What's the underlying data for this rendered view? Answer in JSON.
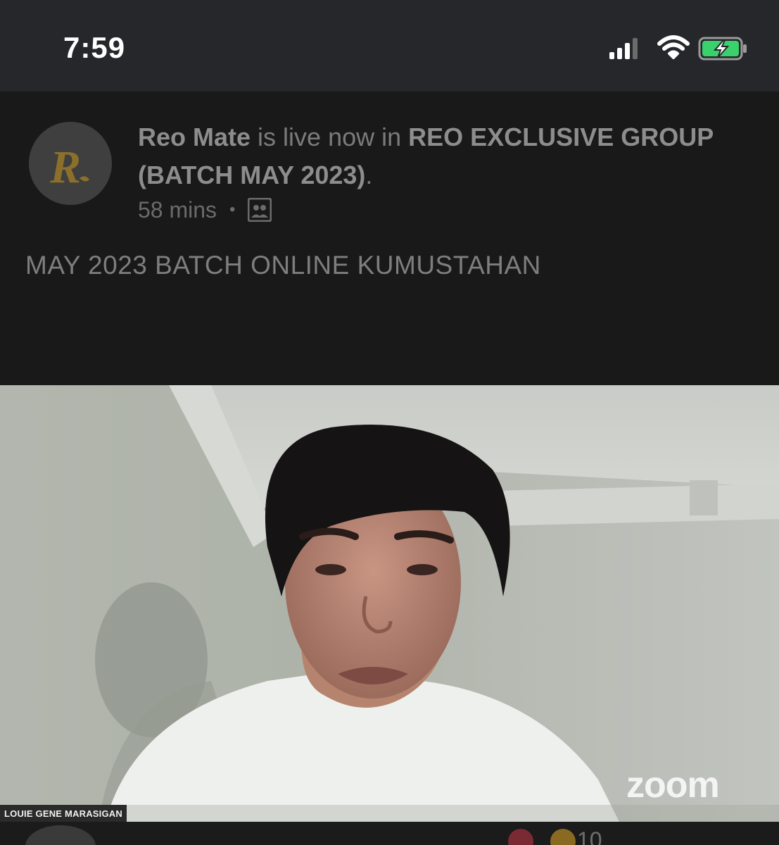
{
  "status_bar": {
    "time": "7:59",
    "icons": [
      "signal-icon",
      "wifi-icon",
      "battery-charging-icon"
    ],
    "battery_color": "#38d16b"
  },
  "post": {
    "author": "Reo Mate",
    "action_text": "is live now in",
    "group_name": "REO EXCLUSIVE GROUP (BATCH MAY 2023)",
    "trailing_punct": ".",
    "time_ago": "58 mins",
    "privacy_icon": "group-icon",
    "text": "MAY 2023 BATCH ONLINE KUMUSTAHAN",
    "avatar_letter": "R"
  },
  "video": {
    "participant_name": "LOUIE GENE MARASIGAN",
    "watermark": "zoom"
  },
  "reactions": {
    "count": "10",
    "icons": [
      "heart-reaction-icon",
      "care-reaction-icon"
    ]
  }
}
